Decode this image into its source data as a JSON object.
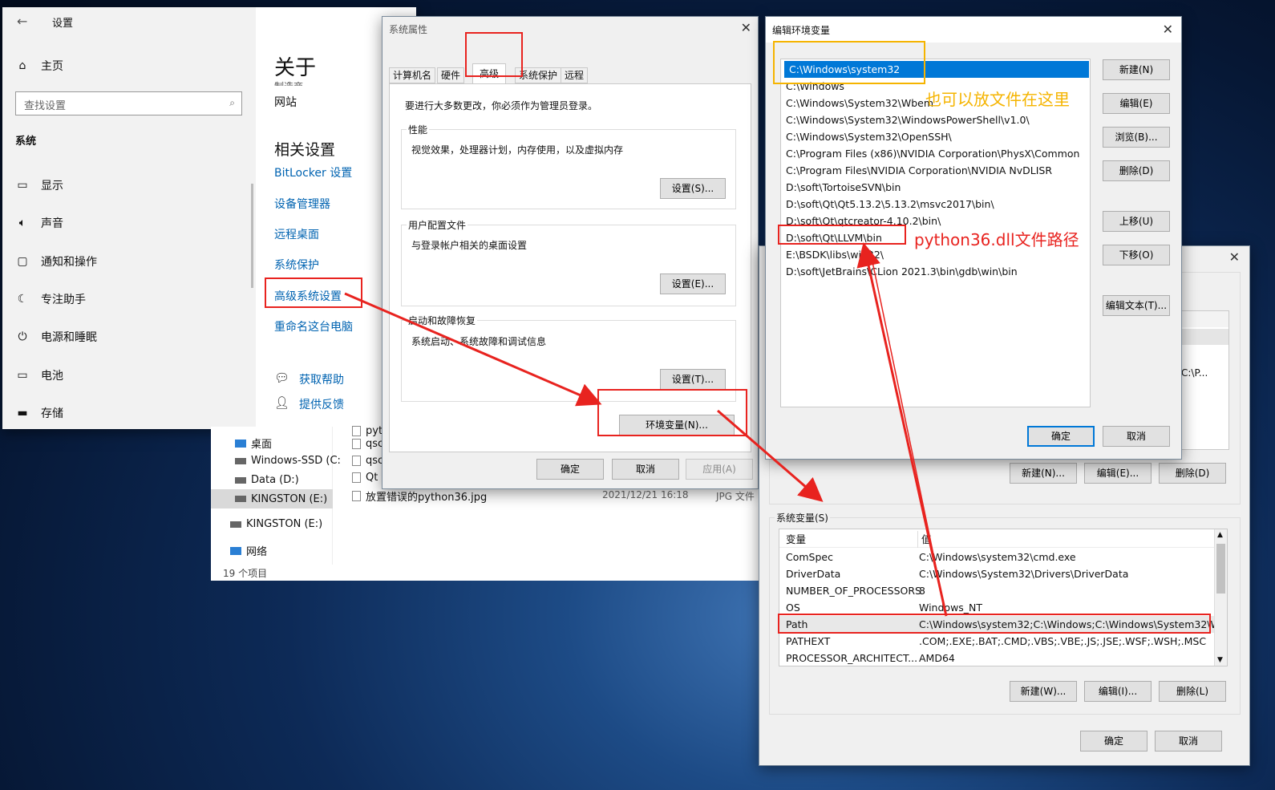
{
  "settings": {
    "title": "设置",
    "home": "主页",
    "search_placeholder": "查找设置",
    "section": "系统",
    "nav": [
      "显示",
      "声音",
      "通知和操作",
      "专注助手",
      "电源和睡眠",
      "电池",
      "存储"
    ],
    "about_title": "关于",
    "cut_text": "制造商",
    "website": "网站",
    "related_title": "相关设置",
    "links": [
      "BitLocker 设置",
      "设备管理器",
      "远程桌面",
      "系统保护",
      "高级系统设置",
      "重命名这台电脑"
    ],
    "help": "获取帮助",
    "feedback": "提供反馈"
  },
  "explorer": {
    "nav": [
      "桌面",
      "Windows-SSD (C:",
      "Data (D:)",
      "KINGSTON (E:)",
      "KINGSTON (E:)",
      "网络"
    ],
    "files": [
      "pyt",
      "qsc",
      "qsc",
      "Qt ("
    ],
    "file_name": "放置错误的python36.jpg",
    "file_date": "2021/12/21 16:18",
    "file_type": "JPG 文件",
    "status": "19 个项目"
  },
  "sysprops": {
    "title": "系统属性",
    "tabs": [
      "计算机名",
      "硬件",
      "高级",
      "系统保护",
      "远程"
    ],
    "admin_note": "要进行大多数更改，你必须作为管理员登录。",
    "perf_label": "性能",
    "perf_desc": "视觉效果，处理器计划，内存使用，以及虚拟内存",
    "profile_label": "用户配置文件",
    "profile_desc": "与登录帐户相关的桌面设置",
    "startup_label": "启动和故障恢复",
    "startup_desc": "系统启动、系统故障和调试信息",
    "settings_s": "设置(S)...",
    "settings_e": "设置(E)...",
    "settings_t": "设置(T)...",
    "env_button": "环境变量(N)...",
    "ok": "确定",
    "cancel": "取消",
    "apply": "应用(A)"
  },
  "editenv": {
    "title": "编辑环境变量",
    "entries": [
      "C:\\Windows\\system32",
      "C:\\Windows",
      "C:\\Windows\\System32\\Wbem",
      "C:\\Windows\\System32\\WindowsPowerShell\\v1.0\\",
      "C:\\Windows\\System32\\OpenSSH\\",
      "C:\\Program Files (x86)\\NVIDIA Corporation\\PhysX\\Common",
      "C:\\Program Files\\NVIDIA Corporation\\NVIDIA NvDLISR",
      "D:\\soft\\TortoiseSVN\\bin",
      "D:\\soft\\Qt\\Qt5.13.2\\5.13.2\\msvc2017\\bin\\",
      "D:\\soft\\Qt\\qtcreator-4.10.2\\bin\\",
      "D:\\soft\\Qt\\LLVM\\bin",
      "E:\\BSDK\\libs\\win32\\",
      "D:\\soft\\JetBrains\\CLion 2021.3\\bin\\gdb\\win\\bin"
    ],
    "buttons": [
      "新建(N)",
      "编辑(E)",
      "浏览(B)...",
      "删除(D)",
      "上移(U)",
      "下移(O)",
      "编辑文本(T)..."
    ],
    "ok": "确定",
    "cancel": "取消"
  },
  "envvars": {
    "user_partial": "C:\\P...",
    "user_new": "新建(N)...",
    "user_edit": "编辑(E)...",
    "user_delete": "删除(D)",
    "sys_label": "系统变量(S)",
    "col_var": "变量",
    "col_val": "值",
    "rows": [
      {
        "name": "ComSpec",
        "value": "C:\\Windows\\system32\\cmd.exe"
      },
      {
        "name": "DriverData",
        "value": "C:\\Windows\\System32\\Drivers\\DriverData"
      },
      {
        "name": "NUMBER_OF_PROCESSORS",
        "value": "8"
      },
      {
        "name": "OS",
        "value": "Windows_NT"
      },
      {
        "name": "Path",
        "value": "C:\\Windows\\system32;C:\\Windows;C:\\Windows\\System32\\Wb..."
      },
      {
        "name": "PATHEXT",
        "value": ".COM;.EXE;.BAT;.CMD;.VBS;.VBE;.JS;.JSE;.WSF;.WSH;.MSC"
      },
      {
        "name": "PROCESSOR_ARCHITECT...",
        "value": "AMD64"
      }
    ],
    "sys_new": "新建(W)...",
    "sys_edit": "编辑(I)...",
    "sys_delete": "删除(L)",
    "ok": "确定",
    "cancel": "取消"
  },
  "annotations": {
    "also_here": "也可以放文件在这里",
    "dll_path": "python36.dll文件路径",
    "orange": "#f5b400",
    "red": "#e8231f"
  }
}
